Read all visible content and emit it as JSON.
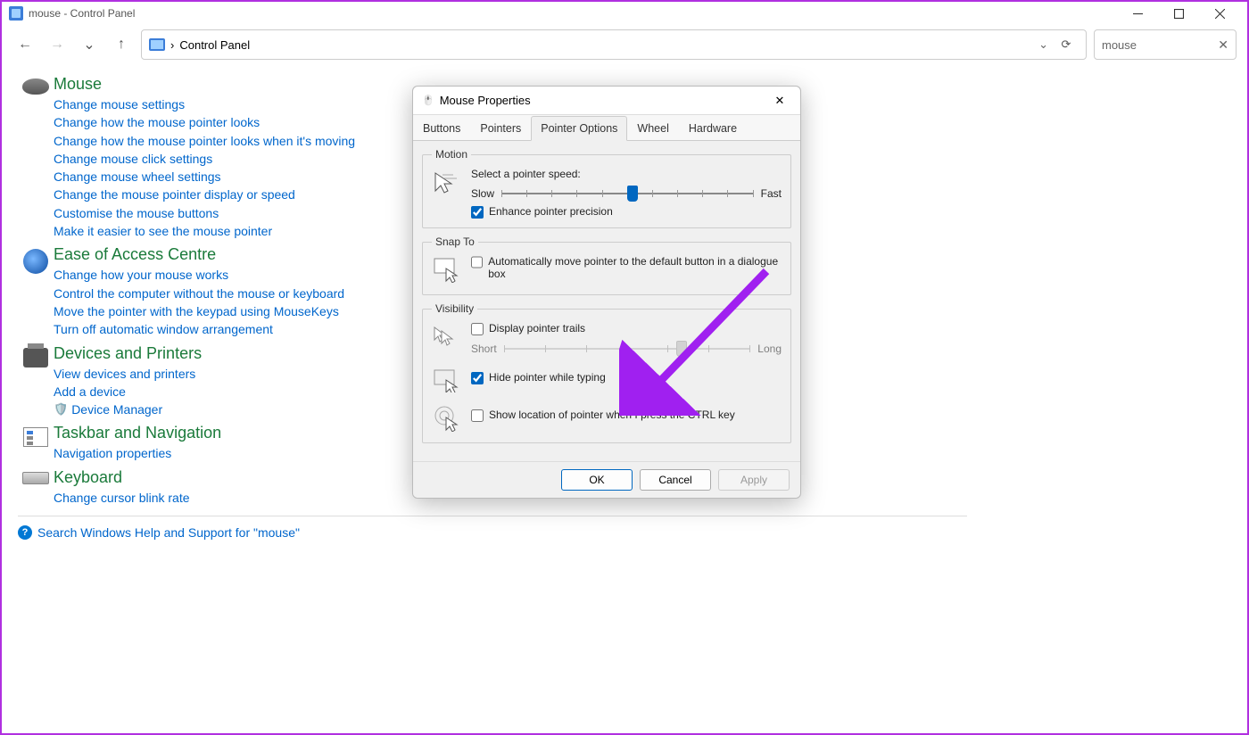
{
  "window": {
    "title": "mouse - Control Panel"
  },
  "breadcrumb": {
    "label": "Control Panel",
    "sep": "›"
  },
  "search": {
    "value": "mouse"
  },
  "sections": {
    "mouse": {
      "title": "Mouse",
      "links": [
        "Change mouse settings",
        "Change how the mouse pointer looks",
        "Change how the mouse pointer looks when it's moving",
        "Change mouse click settings",
        "Change mouse wheel settings",
        "Change the mouse pointer display or speed",
        "Customise the mouse buttons",
        "Make it easier to see the mouse pointer"
      ]
    },
    "eoa": {
      "title": "Ease of Access Centre",
      "links": [
        "Change how your mouse works",
        "Control the computer without the mouse or keyboard",
        "Move the pointer with the keypad using MouseKeys",
        "Turn off automatic window arrangement"
      ]
    },
    "devices": {
      "title": "Devices and Printers",
      "links": [
        "View devices and printers",
        "Add a device"
      ],
      "shield_link": "Device Manager"
    },
    "taskbar": {
      "title": "Taskbar and Navigation",
      "links": [
        "Navigation properties"
      ]
    },
    "keyboard": {
      "title": "Keyboard",
      "links": [
        "Change cursor blink rate"
      ]
    }
  },
  "help": {
    "text": "Search Windows Help and Support for \"mouse\""
  },
  "dialog": {
    "title": "Mouse Properties",
    "tabs": [
      "Buttons",
      "Pointers",
      "Pointer Options",
      "Wheel",
      "Hardware"
    ],
    "active_tab": 2,
    "motion": {
      "legend": "Motion",
      "label": "Select a pointer speed:",
      "slow": "Slow",
      "fast": "Fast",
      "speed_pct": 52,
      "enhance": "Enhance pointer precision",
      "enhance_checked": true
    },
    "snap": {
      "legend": "Snap To",
      "label": "Automatically move pointer to the default button in a dialogue box",
      "checked": false
    },
    "visibility": {
      "legend": "Visibility",
      "trails": "Display pointer trails",
      "trails_checked": false,
      "short": "Short",
      "long": "Long",
      "trail_pct": 72,
      "hide": "Hide pointer while typing",
      "hide_checked": true,
      "ctrl": "Show location of pointer when I press the CTRL key",
      "ctrl_checked": false
    },
    "buttons": {
      "ok": "OK",
      "cancel": "Cancel",
      "apply": "Apply"
    }
  }
}
